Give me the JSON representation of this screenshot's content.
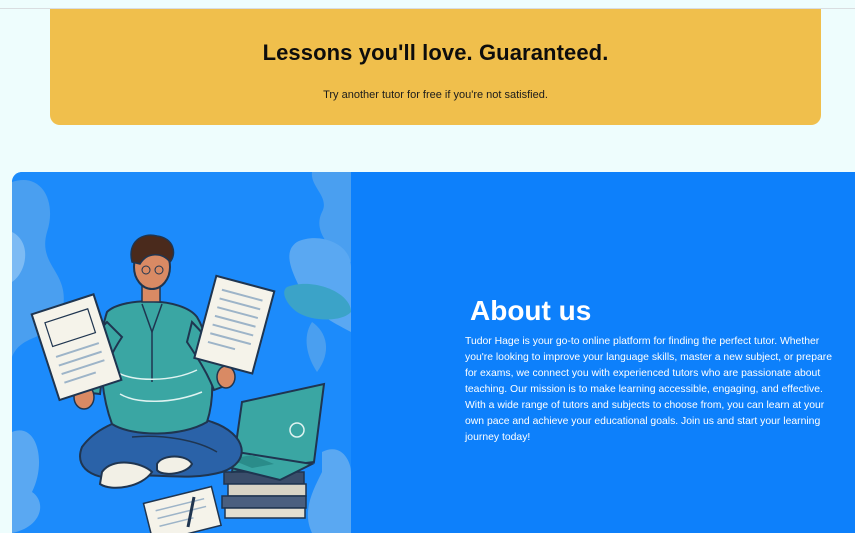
{
  "guarantee": {
    "title": "Lessons you'll love. Guaranteed.",
    "subtitle": "Try another tutor for free if you're not satisfied."
  },
  "about": {
    "title": "About us",
    "body": "Tudor Hage is your go-to online platform for finding the perfect tutor. Whether you're looking to improve your language skills, master a new subject, or prepare for exams, we connect you with experienced tutors who are passionate about teaching. Our mission is to make learning accessible, engaging, and effective. With a wide range of tutors and subjects to choose from, you can learn at your own pace and achieve your educational goals. Join us and start your learning journey today!"
  },
  "colors": {
    "page_background": "#eefdfd",
    "banner_yellow": "#f0bf4c",
    "about_blue": "#0d80fb",
    "illustration_teal": "#3aa6a3"
  },
  "icons": {
    "illustration": "student-reading-papers-with-laptop-illustration"
  }
}
